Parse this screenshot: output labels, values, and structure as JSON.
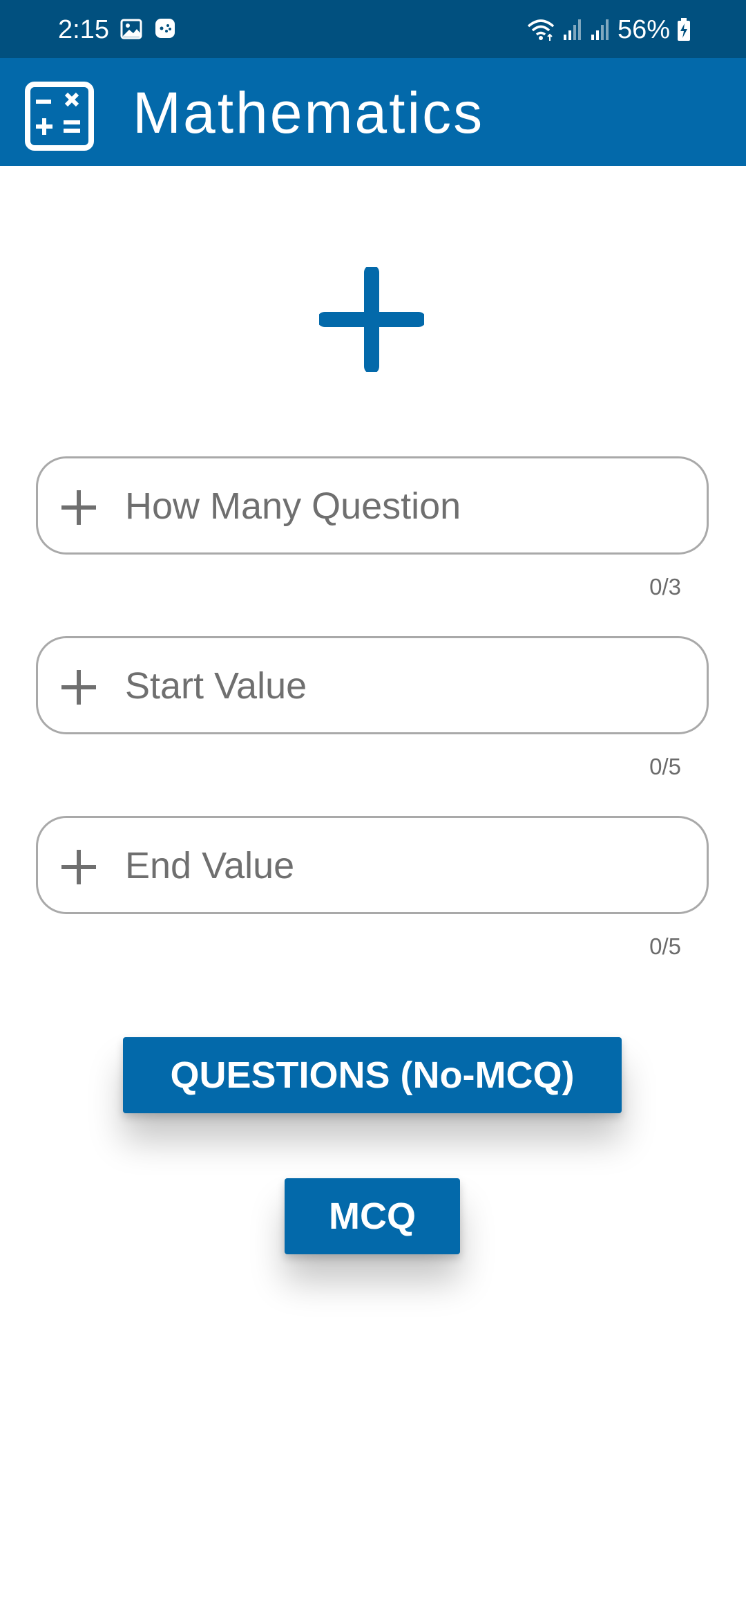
{
  "status_bar": {
    "time": "2:15",
    "battery": "56%",
    "icons": [
      "gallery-icon",
      "game-controller-icon",
      "wifi-icon",
      "signal-icon",
      "signal-icon",
      "battery-charging-icon"
    ]
  },
  "app_bar": {
    "title": "Mathematics",
    "icon": "calculator-icon"
  },
  "operation": {
    "symbol": "plus-icon",
    "color": "#0369aa"
  },
  "fields": [
    {
      "placeholder": "How Many Question",
      "value": "",
      "counter": "0/3",
      "icon": "plus-icon"
    },
    {
      "placeholder": "Start Value",
      "value": "",
      "counter": "0/5",
      "icon": "plus-icon"
    },
    {
      "placeholder": "End Value",
      "value": "",
      "counter": "0/5",
      "icon": "plus-icon"
    }
  ],
  "buttons": {
    "questions_no_mcq": "QUESTIONS (No-MCQ)",
    "mcq": "MCQ"
  },
  "colors": {
    "status_bar": "#01507f",
    "primary": "#0369aa",
    "field_border": "#a9a9a9",
    "hint_text": "#6f6f6f"
  }
}
